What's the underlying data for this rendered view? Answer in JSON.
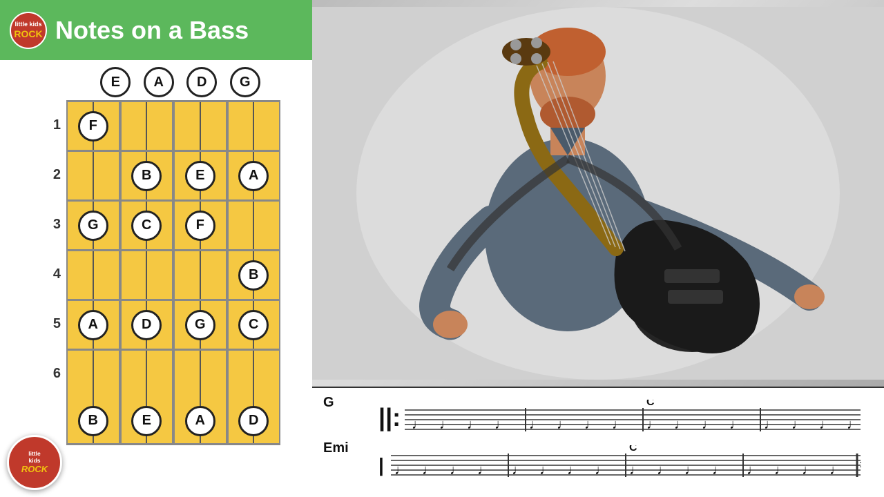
{
  "header": {
    "title": "Notes on a Bass",
    "logo_top_label": "little kids",
    "logo_top_rock": "ROCK"
  },
  "fretboard": {
    "strings": [
      "E",
      "A",
      "D",
      "G"
    ],
    "frets": [
      {
        "number": "1",
        "notes": [
          {
            "string": 0,
            "note": "F"
          },
          {
            "string": 1,
            "note": ""
          },
          {
            "string": 2,
            "note": ""
          },
          {
            "string": 3,
            "note": ""
          }
        ]
      },
      {
        "number": "2",
        "notes": [
          {
            "string": 0,
            "note": ""
          },
          {
            "string": 1,
            "note": "B"
          },
          {
            "string": 2,
            "note": "E"
          },
          {
            "string": 3,
            "note": "A"
          }
        ]
      },
      {
        "number": "3",
        "notes": [
          {
            "string": 0,
            "note": "G"
          },
          {
            "string": 1,
            "note": "C"
          },
          {
            "string": 2,
            "note": "F"
          },
          {
            "string": 3,
            "note": ""
          }
        ]
      },
      {
        "number": "4",
        "notes": [
          {
            "string": 0,
            "note": ""
          },
          {
            "string": 1,
            "note": ""
          },
          {
            "string": 2,
            "note": ""
          },
          {
            "string": 3,
            "note": "B"
          }
        ]
      },
      {
        "number": "5",
        "notes": [
          {
            "string": 0,
            "note": "A"
          },
          {
            "string": 1,
            "note": "D"
          },
          {
            "string": 2,
            "note": "G"
          },
          {
            "string": 3,
            "note": "C"
          }
        ]
      },
      {
        "number": "6",
        "notes": [
          {
            "string": 0,
            "note": ""
          },
          {
            "string": 1,
            "note": ""
          },
          {
            "string": 2,
            "note": ""
          },
          {
            "string": 3,
            "note": ""
          }
        ]
      },
      {
        "number": "",
        "notes": [
          {
            "string": 0,
            "note": "B"
          },
          {
            "string": 1,
            "note": "E"
          },
          {
            "string": 2,
            "note": "A"
          },
          {
            "string": 3,
            "note": "D"
          }
        ]
      }
    ]
  },
  "logo": {
    "little_kids": "little kids",
    "rock": "ROCK"
  },
  "sheet_music": {
    "rows": [
      {
        "chord_left": "G",
        "chord_right": "C",
        "marks": [
          "♩",
          "♩",
          "♩",
          "♩",
          "♩",
          "♩",
          "♩",
          "♩",
          "♩",
          "♩",
          "♩",
          "♩",
          "♩",
          "♩",
          "♩",
          "♩"
        ]
      },
      {
        "chord_left": "Emi",
        "chord_right": "C",
        "marks": [
          "♩",
          "♩",
          "♩",
          "♩",
          "♩",
          "♩",
          "♩",
          "♩",
          "♩",
          "♩",
          "♩",
          "♩",
          "♩",
          "♩",
          "♩",
          "♩"
        ]
      }
    ]
  },
  "colors": {
    "green": "#5cb85c",
    "red": "#c0392b",
    "yellow": "#f5c842",
    "text_white": "#ffffff"
  }
}
